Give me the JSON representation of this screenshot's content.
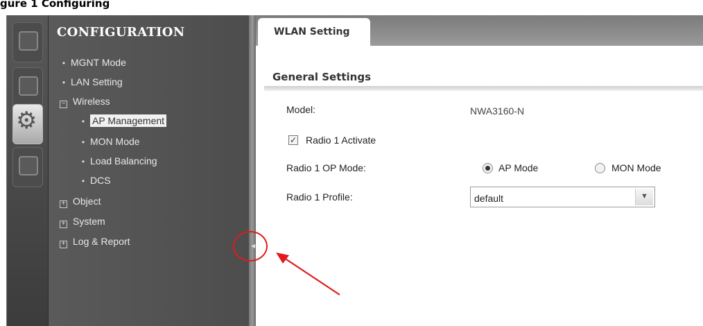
{
  "figure_caption": "gure 1 Configuring",
  "nav": {
    "title": "CONFIGURATION",
    "items": [
      {
        "label": "MGNT Mode"
      },
      {
        "label": "LAN Setting"
      },
      {
        "label": "Wireless"
      },
      {
        "label": "AP Management"
      },
      {
        "label": "MON Mode"
      },
      {
        "label": "Load Balancing"
      },
      {
        "label": "DCS"
      },
      {
        "label": "Object"
      },
      {
        "label": "System"
      },
      {
        "label": "Log & Report"
      }
    ],
    "selected": "AP Management"
  },
  "tabs": [
    {
      "label": "WLAN Setting"
    }
  ],
  "main": {
    "section_title": "General Settings",
    "model_label": "Model:",
    "model_value": "NWA3160-N",
    "radio1_activate_label": "Radio 1 Activate",
    "radio1_activate_checked": true,
    "op_mode_label": "Radio 1 OP Mode:",
    "op_mode_options": [
      "AP Mode",
      "MON Mode"
    ],
    "op_mode_selected": "AP Mode",
    "profile_label": "Radio 1 Profile:",
    "profile_value": "default"
  },
  "icons": {
    "rail": [
      "monitor-icon",
      "screen-icon",
      "gear-icon",
      "maintenance-icon"
    ],
    "expand": "plus-box-icon",
    "collapse": "minus-box-icon",
    "dropdown": "chevron-down-icon"
  },
  "colors": {
    "callout": "#e01b1b",
    "nav_bg": "#555555"
  }
}
